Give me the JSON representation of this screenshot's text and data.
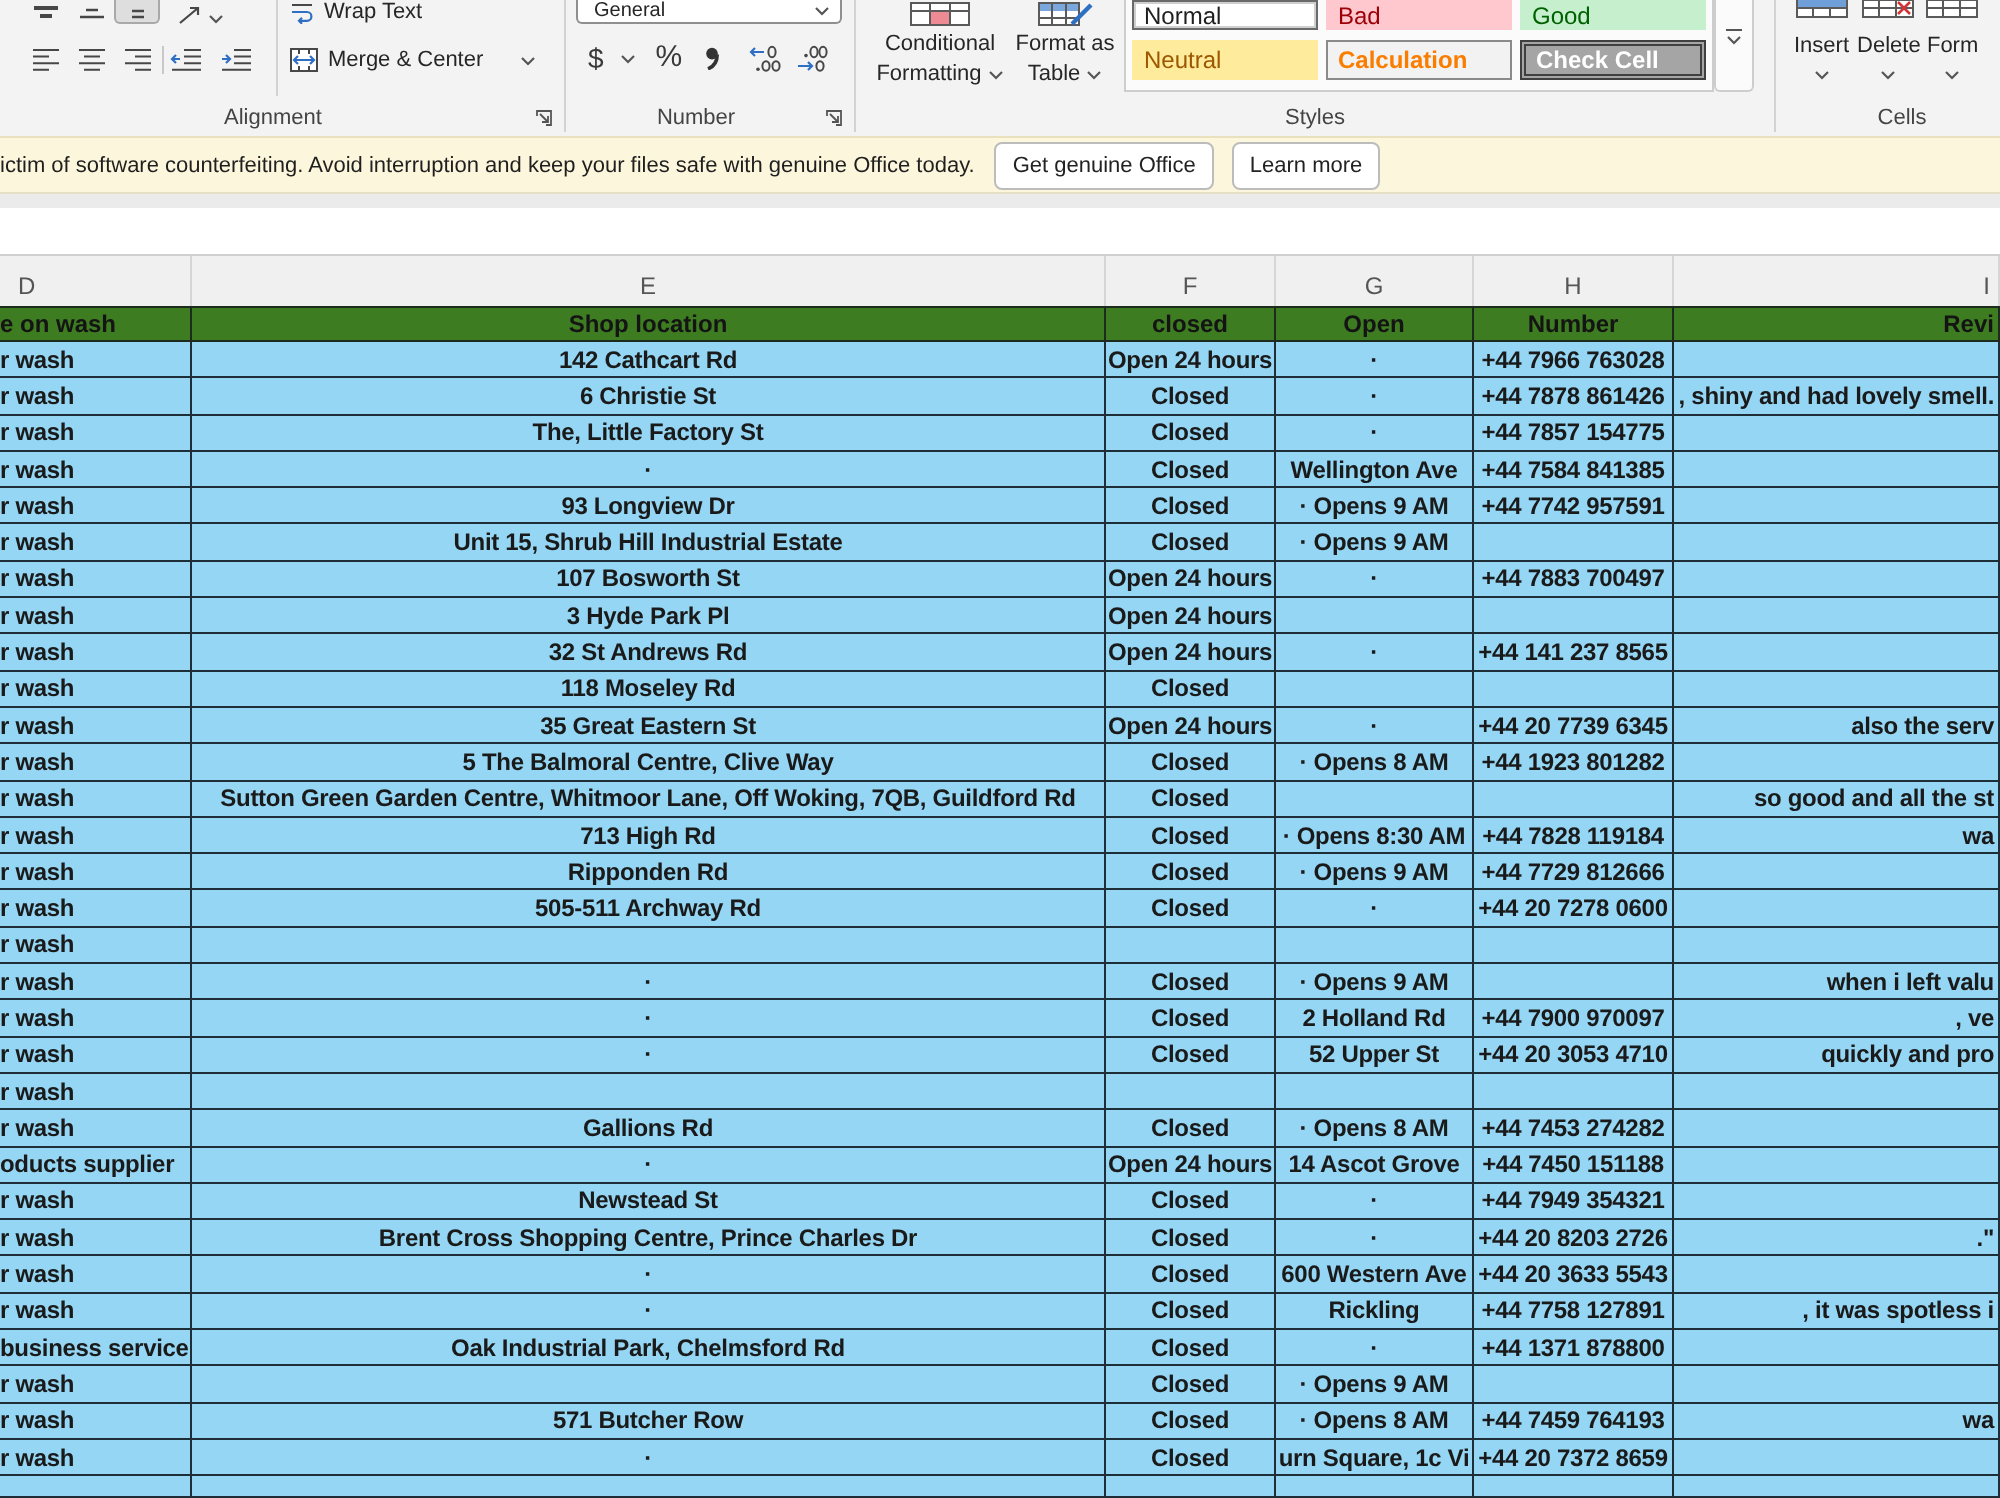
{
  "ribbon": {
    "alignment": {
      "label": "Alignment",
      "vertical_align": [
        {
          "selected": false
        },
        {
          "selected": false
        },
        {
          "selected": true
        }
      ],
      "wrap_text": "Wrap Text",
      "merge_center": "Merge & Center"
    },
    "number": {
      "label": "Number",
      "format": "General",
      "currency": "$",
      "percent": "%"
    },
    "styles": {
      "label": "Styles",
      "conditional_formatting": "Conditional Formatting",
      "format_as_table": "Format as Table",
      "cell_styles": [
        {
          "label": "Normal",
          "kind": "normal",
          "selected": true
        },
        {
          "label": "Bad",
          "kind": "bad",
          "selected": false
        },
        {
          "label": "Good",
          "kind": "good",
          "selected": false
        },
        {
          "label": "Neutral",
          "kind": "neutral",
          "selected": false
        },
        {
          "label": "Calculation",
          "kind": "calculation",
          "selected": false
        },
        {
          "label": "Check Cell",
          "kind": "check",
          "selected": false
        }
      ]
    },
    "cells": {
      "label": "Cells",
      "buttons": [
        "Insert",
        "Delete",
        "Form"
      ]
    }
  },
  "banner": {
    "message": "ictim of software counterfeiting. Avoid interruption and keep your files safe with genuine Office today.",
    "buttons": [
      "Get genuine Office",
      "Learn more"
    ]
  },
  "sheet": {
    "column_letters": [
      "D",
      "E",
      "F",
      "G",
      "H",
      "I"
    ],
    "header": [
      "e on wash",
      "Shop location",
      "closed",
      "Open",
      "Number",
      "Revi"
    ],
    "rows": [
      {
        "column_d": "r wash",
        "shop_location": "142 Cathcart Rd",
        "closed": "Open 24 hours",
        "open": "·",
        "number": "+44 7966 763028"
      },
      {
        "column_d": "r wash",
        "shop_location": "6 Christie St",
        "closed": "Closed",
        "open": "·",
        "number": "+44 7878 861426",
        "column_i": ", shiny and had lovely smell."
      },
      {
        "column_d": "r wash",
        "shop_location": "The, Little Factory St",
        "closed": "Closed",
        "open": "·",
        "number": "+44 7857 154775"
      },
      {
        "column_d": "r wash",
        "shop_location": "·",
        "closed": "Closed",
        "open": "Wellington Ave",
        "number": "+44 7584 841385"
      },
      {
        "column_d": "r wash",
        "shop_location": "93 Longview Dr",
        "closed": "Closed",
        "open": "· Opens 9 AM",
        "number": "+44 7742 957591"
      },
      {
        "column_d": "r wash",
        "shop_location": "Unit 15, Shrub Hill Industrial Estate",
        "closed": "Closed",
        "open": "· Opens 9 AM"
      },
      {
        "column_d": "r wash",
        "shop_location": "107 Bosworth St",
        "closed": "Open 24 hours",
        "open": "·",
        "number": "+44 7883 700497"
      },
      {
        "column_d": "r wash",
        "shop_location": "3 Hyde Park Pl",
        "closed": "Open 24 hours"
      },
      {
        "column_d": "r wash",
        "shop_location": "32 St Andrews Rd",
        "closed": "Open 24 hours",
        "open": "·",
        "number": "+44 141 237 8565"
      },
      {
        "column_d": "r wash",
        "shop_location": "118 Moseley Rd",
        "closed": "Closed"
      },
      {
        "column_d": "r wash",
        "shop_location": "35 Great Eastern St",
        "closed": "Open 24 hours",
        "open": "·",
        "number": "+44 20 7739 6345",
        "column_i": "also the serv"
      },
      {
        "column_d": "r wash",
        "shop_location": "5 The Balmoral Centre, Clive Way",
        "closed": "Closed",
        "open": "· Opens 8 AM",
        "number": "+44 1923 801282"
      },
      {
        "column_d": "r wash",
        "shop_location": "Sutton Green Garden Centre, Whitmoor Lane, Off Woking, 7QB, Guildford Rd",
        "closed": "Closed",
        "column_i": "so good and all the st"
      },
      {
        "column_d": "r wash",
        "shop_location": "713 High Rd",
        "closed": "Closed",
        "open": "· Opens 8:30 AM",
        "number": "+44 7828 119184",
        "column_i": "wa"
      },
      {
        "column_d": "r wash",
        "shop_location": "Ripponden Rd",
        "closed": "Closed",
        "open": "· Opens 9 AM",
        "number": "+44 7729 812666"
      },
      {
        "column_d": "r wash",
        "shop_location": "505-511 Archway Rd",
        "closed": "Closed",
        "open": "·",
        "number": "+44 20 7278 0600"
      },
      {
        "column_d": "r wash"
      },
      {
        "column_d": "r wash",
        "shop_location": "·",
        "closed": "Closed",
        "open": "· Opens 9 AM",
        "column_i": "when i left valu"
      },
      {
        "column_d": "r wash",
        "shop_location": "·",
        "closed": "Closed",
        "open": "2 Holland Rd",
        "number": "+44 7900 970097",
        "column_i": ", ve"
      },
      {
        "column_d": "r wash",
        "shop_location": "·",
        "closed": "Closed",
        "open": "52 Upper St",
        "number": "+44 20 3053 4710",
        "column_i": "quickly and pro"
      },
      {
        "column_d": "r wash"
      },
      {
        "column_d": "r wash",
        "shop_location": "Gallions Rd",
        "closed": "Closed",
        "open": "· Opens 8 AM",
        "number": "+44 7453 274282"
      },
      {
        "column_d": "oducts supplier",
        "shop_location": "·",
        "closed": "Open 24 hours",
        "open": "14 Ascot Grove",
        "number": "+44 7450 151188"
      },
      {
        "column_d": "r wash",
        "shop_location": "Newstead St",
        "closed": "Closed",
        "open": "·",
        "number": "+44 7949 354321"
      },
      {
        "column_d": "r wash",
        "shop_location": "Brent Cross Shopping Centre, Prince Charles Dr",
        "closed": "Closed",
        "open": "·",
        "number": "+44 20 8203 2726",
        "column_i": ".\""
      },
      {
        "column_d": "r wash",
        "shop_location": "·",
        "closed": "Closed",
        "open": "600 Western Ave",
        "number": "+44 20 3633 5543"
      },
      {
        "column_d": "r wash",
        "shop_location": "·",
        "closed": "Closed",
        "open": "Rickling",
        "number": "+44 7758 127891",
        "column_i": ", it was spotless i"
      },
      {
        "column_d": "business service",
        "shop_location": "Oak Industrial Park, Chelmsford Rd",
        "closed": "Closed",
        "open": "·",
        "number": "+44 1371 878800"
      },
      {
        "column_d": "r wash",
        "closed": "Closed",
        "open": "· Opens 9 AM"
      },
      {
        "column_d": "r wash",
        "shop_location": "571 Butcher Row",
        "closed": "Closed",
        "open": "· Opens 8 AM",
        "number": "+44 7459 764193",
        "column_i": "wa"
      },
      {
        "column_d": "r wash",
        "shop_location": "·",
        "closed": "Closed",
        "open": "urn Square, 1c Vi",
        "number": "+44 20 7372 8659"
      }
    ]
  }
}
